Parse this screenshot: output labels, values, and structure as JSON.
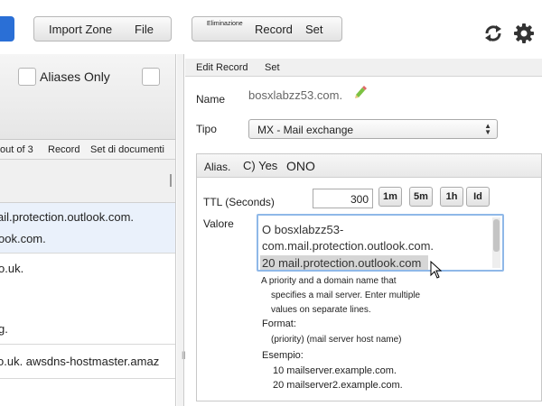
{
  "toolbar": {
    "import_zone_file": [
      "Import Zone",
      "File"
    ],
    "record_set": {
      "small": "Eliminazione",
      "a": "Record",
      "b": "Set"
    },
    "refresh_icon": "refresh-icon",
    "settings_icon": "gear-icon"
  },
  "left_panel": {
    "aliases_only": "Aliases Only",
    "pager": {
      "of": "out of 3",
      "record": "Record",
      "set": "Set di documenti"
    },
    "rows": [
      {
        "line1": "ail.protection.outlook.com.",
        "line2": "ook.com."
      },
      {
        "line1": "o.uk.",
        "line2": "",
        "line3": "g."
      },
      {
        "line1": "o.uk. awsdns-hostmaster.amaz"
      }
    ]
  },
  "right_panel": {
    "tabs": {
      "edit": "Edit Record",
      "set": "Set"
    },
    "name_label": "Name",
    "name_value": "bosxlabzz53.com.",
    "type_label": "Tipo",
    "type_value": "MX - Mail exchange",
    "alias_label": "Alias.",
    "alias_yes": "C) Yes",
    "alias_no": "ONO",
    "ttl_label": "TTL (Seconds)",
    "ttl_value": "300",
    "ttl_buttons": [
      "1m",
      "5m",
      "1h",
      "Id"
    ],
    "value_label": "Valore",
    "value_lines": [
      "O bosxlabzz53-",
      "com.mail.protection.outlook.com.",
      "20 mail.protection.outlook.com"
    ],
    "help_lines": [
      "A priority and a domain name that",
      "specifies a mail server. Enter multiple",
      "values on separate lines."
    ],
    "format_label": "Format:",
    "format_value": "(priority) (mail server host name)",
    "example_label": "Esempio:",
    "example_lines": [
      "10 mailserver.example.com.",
      "20 mailserver2.example.com."
    ]
  }
}
